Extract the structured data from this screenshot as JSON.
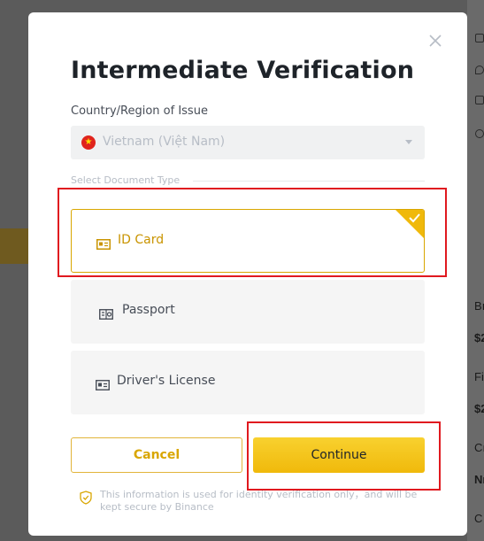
{
  "modal": {
    "title": "Intermediate Verification",
    "country_label": "Country/Region of Issue",
    "country_value": "Vietnam (Việt Nam)",
    "document_type_label": "Select Document Type",
    "documents": [
      {
        "label": "ID Card",
        "icon": "id-card-icon",
        "selected": true
      },
      {
        "label": "Passport",
        "icon": "passport-icon",
        "selected": false
      },
      {
        "label": "Driver's License",
        "icon": "drivers-license-icon",
        "selected": false
      }
    ],
    "cancel_label": "Cancel",
    "continue_label": "Continue",
    "info_text": "This information is used for identity verification only，and will be kept secure by Binance"
  },
  "background": {
    "fragments": [
      "Bı",
      "$2",
      "Fi",
      "$2",
      "Cı",
      "Nı",
      "C"
    ]
  },
  "colors": {
    "accent": "#f0b90b",
    "accent_text": "#c99400",
    "highlight": "#e0191f",
    "title": "#1e2329"
  }
}
